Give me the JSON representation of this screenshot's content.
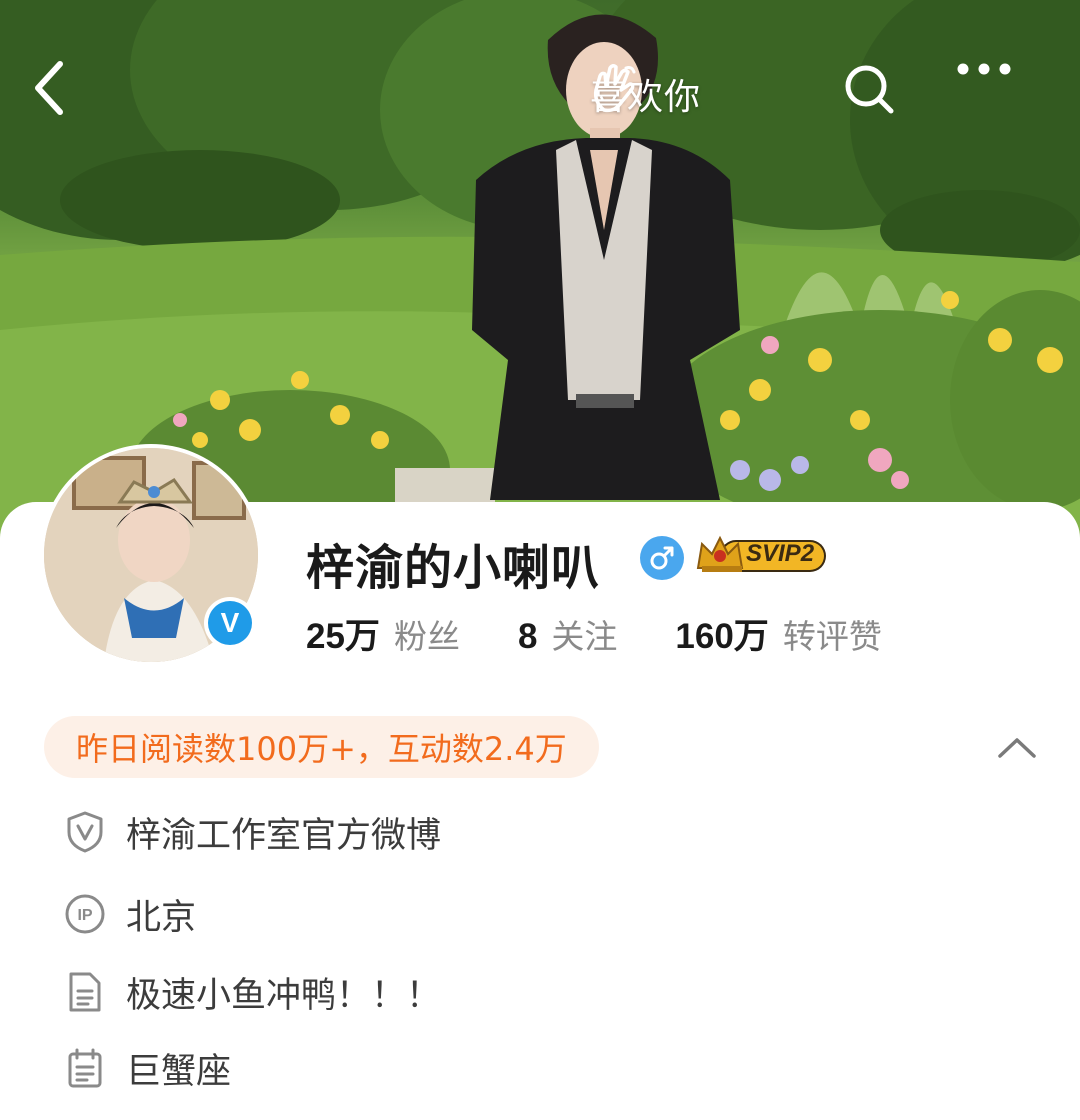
{
  "header": {
    "like_label": "喜欢你",
    "icons": [
      "back-icon",
      "wave-hand-icon",
      "search-icon",
      "more-icon"
    ]
  },
  "profile": {
    "name": "梓渝的小喇叭",
    "gender": "male",
    "vip_badge": "SVIP2",
    "verified": true,
    "stats": [
      {
        "value": "25万",
        "label": "粉丝"
      },
      {
        "value": "8",
        "label": "关注"
      },
      {
        "value": "160万",
        "label": "转评赞"
      }
    ]
  },
  "highlight": {
    "text": "昨日阅读数100万+，互动数2.4万"
  },
  "info": {
    "verification": "梓渝工作室官方微博",
    "ip_location": "北京",
    "bio": "极速小鱼冲鸭！！！",
    "constellation": "巨蟹座"
  },
  "colors": {
    "accent_orange": "#f26b1d",
    "pill_bg": "#fdf0e7",
    "verify_blue": "#1f9be8",
    "gender_blue": "#4aa7ee",
    "vip_gold": "#f2b625"
  }
}
